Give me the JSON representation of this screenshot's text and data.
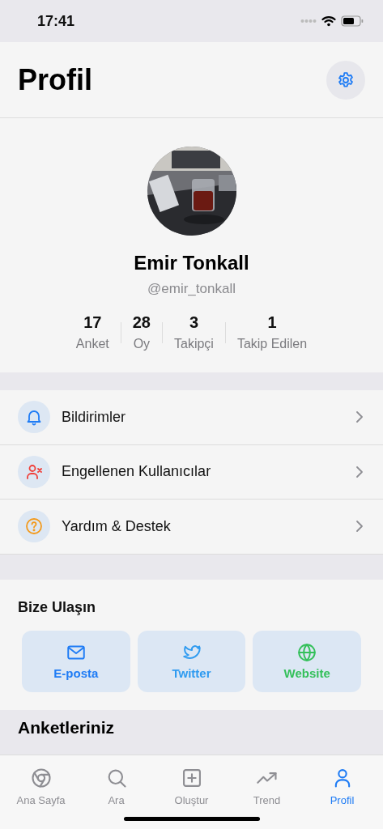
{
  "status_bar": {
    "time": "17:41"
  },
  "header": {
    "title": "Profil"
  },
  "profile": {
    "name": "Emir Tonkall",
    "handle": "@emir_tonkall",
    "stats": [
      {
        "value": "17",
        "label": "Anket"
      },
      {
        "value": "28",
        "label": "Oy"
      },
      {
        "value": "3",
        "label": "Takipçi"
      },
      {
        "value": "1",
        "label": "Takip Edilen"
      }
    ]
  },
  "menu_items": [
    {
      "kind": "notifications",
      "label": "Bildirimler"
    },
    {
      "kind": "blocked",
      "label": "Engellenen Kullanıcılar"
    },
    {
      "kind": "help",
      "label": "Yardım & Destek"
    }
  ],
  "contact": {
    "title": "Bize Ulaşın",
    "buttons": [
      {
        "kind": "email",
        "label": "E-posta"
      },
      {
        "kind": "twitter",
        "label": "Twitter"
      },
      {
        "kind": "website",
        "label": "Website"
      }
    ]
  },
  "polls_section": {
    "title": "Anketleriniz"
  },
  "tab_bar": [
    {
      "kind": "home",
      "label": "Ana Sayfa",
      "selected": false
    },
    {
      "kind": "search",
      "label": "Ara",
      "selected": false
    },
    {
      "kind": "create",
      "label": "Oluştur",
      "selected": false
    },
    {
      "kind": "trend",
      "label": "Trend",
      "selected": false
    },
    {
      "kind": "profile",
      "label": "Profil",
      "selected": true
    }
  ]
}
